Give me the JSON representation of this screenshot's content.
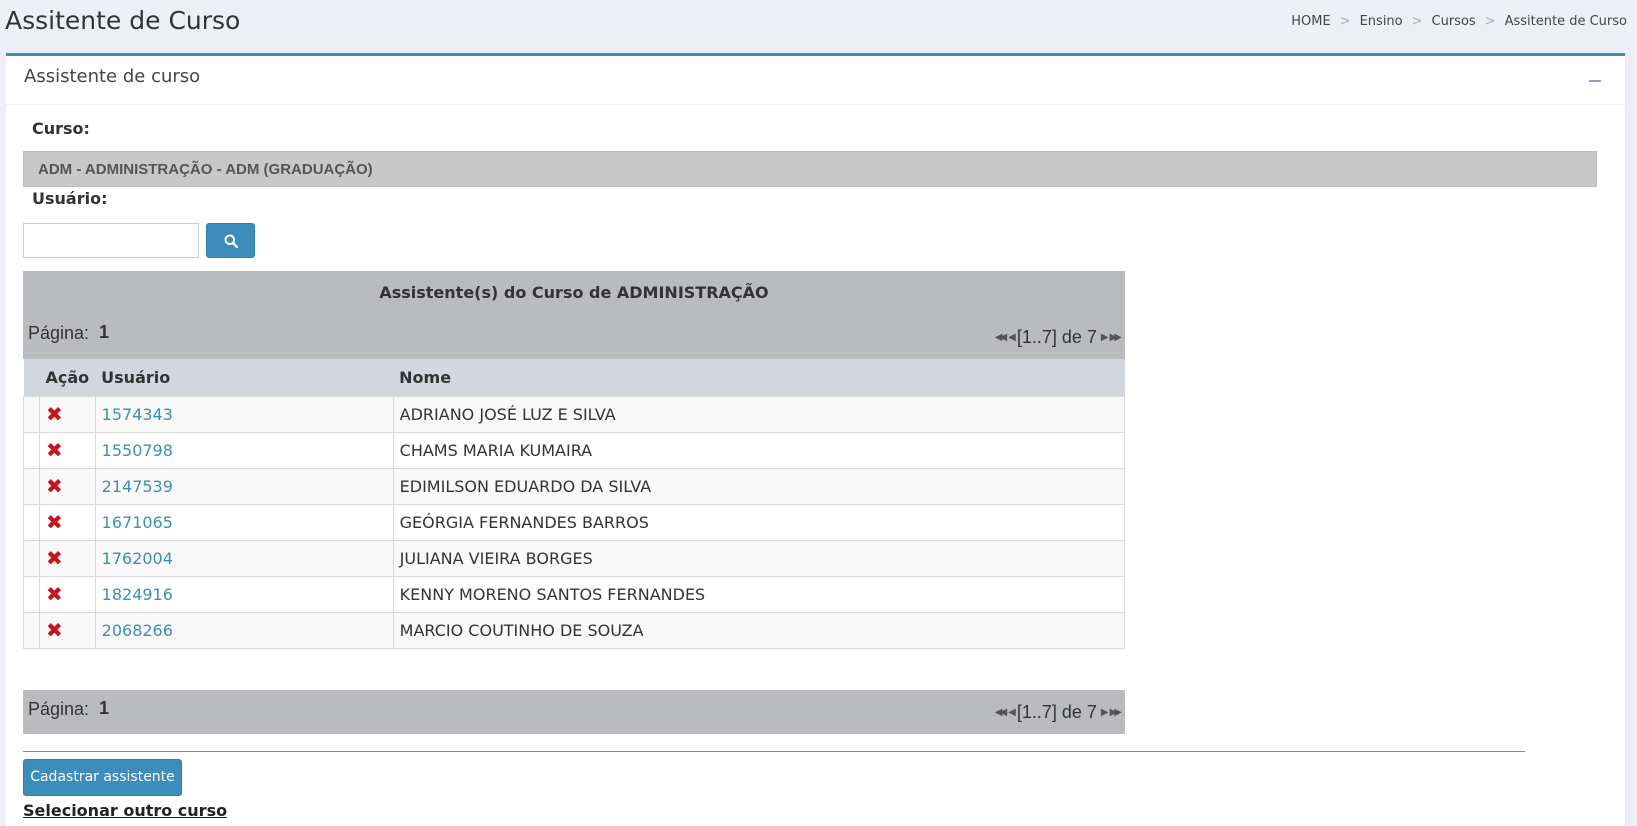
{
  "header": {
    "title": "Assitente de Curso",
    "breadcrumb": [
      "HOME",
      "Ensino",
      "Cursos",
      "Assitente de Curso"
    ],
    "breadcrumb_sep": ">"
  },
  "box": {
    "title": "Assistente de curso"
  },
  "form": {
    "course_label": "Curso:",
    "course_value": "ADM - ADMINISTRAÇÃO - ADM (GRADUAÇÃO)",
    "user_label": "Usuário:",
    "user_value": "",
    "search_icon": "search-icon"
  },
  "table": {
    "caption": "Assistente(s) do Curso de ADMINISTRAÇÃO",
    "page_label": "Página:",
    "page_number": "1",
    "range_text": "[1..7] de 7",
    "columns": [
      "",
      "Ação",
      "Usuário",
      "Nome"
    ],
    "rows": [
      {
        "user": "1574343",
        "name": "ADRIANO JOSÉ LUZ E SILVA"
      },
      {
        "user": "1550798",
        "name": "CHAMS MARIA KUMAIRA"
      },
      {
        "user": "2147539",
        "name": "EDIMILSON EDUARDO DA SILVA"
      },
      {
        "user": "1671065",
        "name": "GEÓRGIA FERNANDES BARROS"
      },
      {
        "user": "1762004",
        "name": "JULIANA VIEIRA BORGES"
      },
      {
        "user": "1824916",
        "name": "KENNY MORENO SANTOS FERNANDES"
      },
      {
        "user": "2068266",
        "name": "MARCIO COUTINHO DE SOUZA"
      }
    ],
    "delete_icon": "✖"
  },
  "actions": {
    "register_label": "Cadastrar assistente",
    "other_course_label": "Selecionar outro curso"
  },
  "colors": {
    "accent": "#3c8dbc",
    "delete": "#c9141b"
  }
}
